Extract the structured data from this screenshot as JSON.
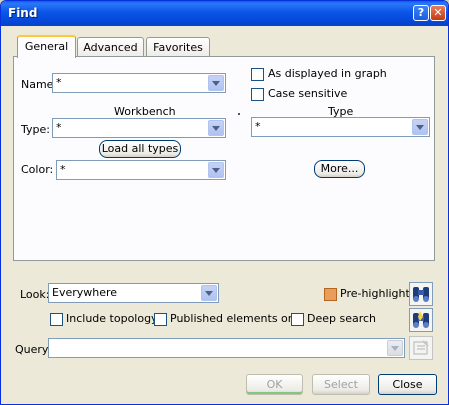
{
  "window": {
    "title": "Find"
  },
  "tabs": [
    {
      "label": "General"
    },
    {
      "label": "Advanced"
    },
    {
      "label": "Favorites"
    }
  ],
  "general": {
    "name_label": "Name:",
    "name_value": "*",
    "workbench_label": "Workbench",
    "type_label": "Type:",
    "workbench_value": "*",
    "load_all_types": "Load all types",
    "color_label": "Color:",
    "color_value": "*",
    "as_displayed": "As displayed in graph",
    "case_sensitive": "Case sensitive",
    "type_header": "Type",
    "type_value": "*",
    "more_button": "More..."
  },
  "search": {
    "look_label": "Look:",
    "look_value": "Everywhere",
    "pre_highlight": "Pre-highlight",
    "include_topology": "Include topology",
    "published_only": "Published elements only",
    "deep_search": "Deep search",
    "query_label": "Query:",
    "query_value": ""
  },
  "buttons": {
    "ok": "OK",
    "select": "Select",
    "close": "Close"
  },
  "colors": {
    "titlebar": "#0a55e8",
    "window_bg": "#ece9d8",
    "prehighlight_check": "#e89e5a"
  }
}
